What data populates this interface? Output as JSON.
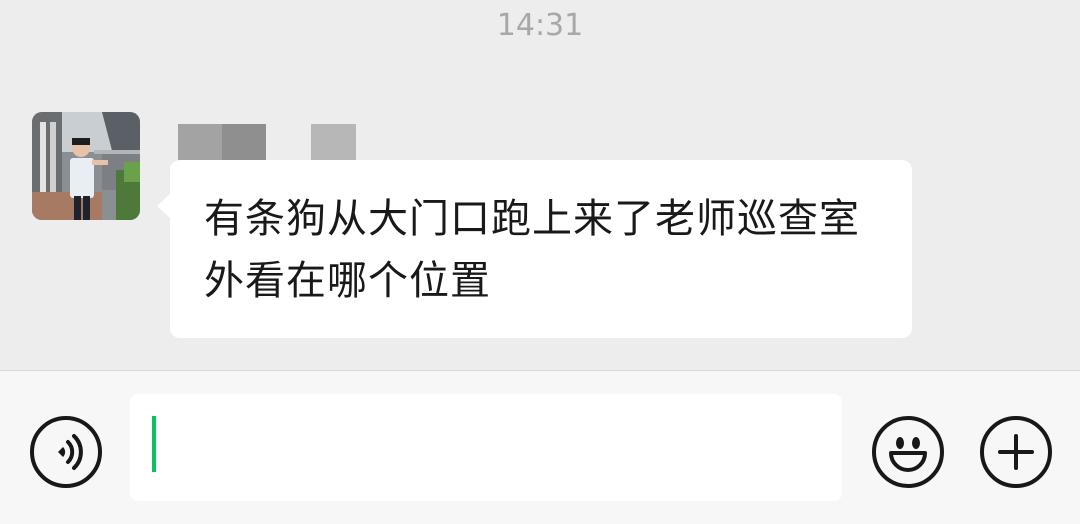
{
  "chat": {
    "timestamp": "14:31",
    "message": {
      "text": "有条狗从大门口跑上来了老师巡查室外看在哪个位置",
      "sender_avatar": "avatar-photo",
      "sender_name_blurred": true
    }
  },
  "input_bar": {
    "value": "",
    "voice_icon": "voice-icon",
    "emoji_icon": "emoji-icon",
    "plus_icon": "plus-icon",
    "caret_color": "#07c160"
  },
  "colors": {
    "background": "#ededed",
    "bubble": "#ffffff",
    "input_bar": "#f7f7f7",
    "accent": "#07c160"
  }
}
